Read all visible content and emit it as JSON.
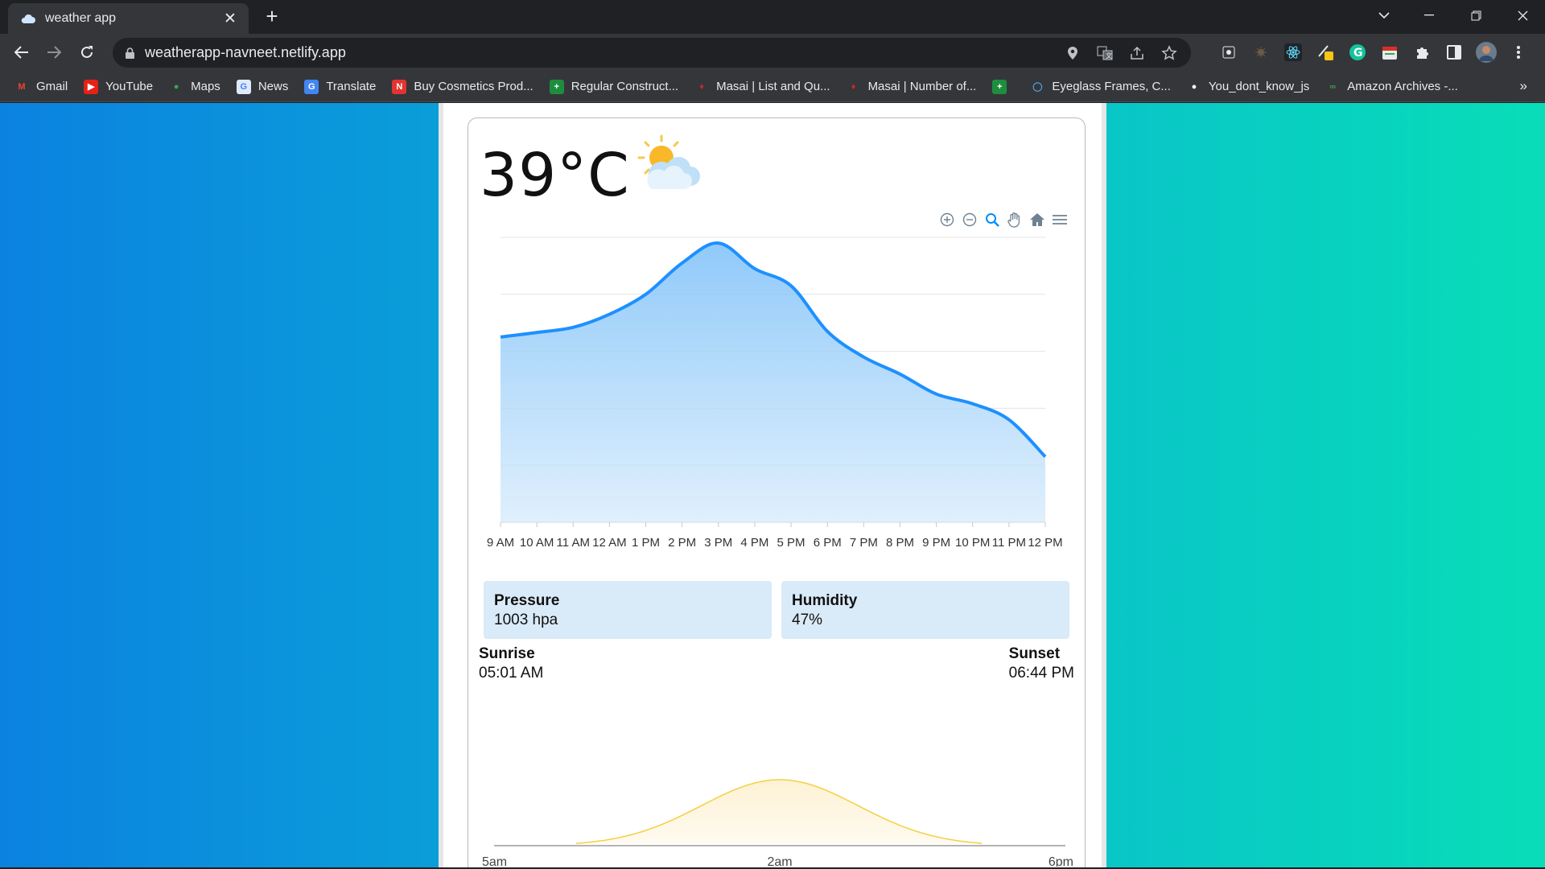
{
  "browser": {
    "tab_title": "weather app",
    "url": "weatherapp-navneet.netlify.app",
    "bookmarks": [
      {
        "label": "Gmail",
        "icon": "gmail-icon"
      },
      {
        "label": "YouTube",
        "icon": "youtube-icon"
      },
      {
        "label": "Maps",
        "icon": "maps-icon"
      },
      {
        "label": "News",
        "icon": "news-icon"
      },
      {
        "label": "Translate",
        "icon": "translate-icon"
      },
      {
        "label": "Buy Cosmetics Prod...",
        "icon": "cosmetics-icon"
      },
      {
        "label": "Regular Construct...",
        "icon": "sheets-icon"
      },
      {
        "label": "Masai | List and Qu...",
        "icon": "masai-icon"
      },
      {
        "label": "Masai | Number of...",
        "icon": "masai-icon"
      },
      {
        "label": "",
        "icon": "sheets-icon"
      },
      {
        "label": "Eyeglass Frames, C...",
        "icon": "eyeglass-icon"
      },
      {
        "label": "You_dont_know_js",
        "icon": "github-icon"
      },
      {
        "label": "Amazon Archives -...",
        "icon": "amazon-icon"
      }
    ],
    "bookmarks_more": "»"
  },
  "weather": {
    "temperature": "39°C",
    "icon": "partly-cloudy-sun-icon",
    "pressure_label": "Pressure",
    "pressure_value": "1003 hpa",
    "humidity_label": "Humidity",
    "humidity_value": "47%",
    "sunrise_label": "Sunrise",
    "sunrise_value": "05:01 AM",
    "sunset_label": "Sunset",
    "sunset_value": "06:44 PM"
  },
  "chart_data": [
    {
      "type": "area",
      "title": "",
      "xlabel": "",
      "ylabel": "",
      "categories": [
        "9 AM",
        "10 AM",
        "11 AM",
        "12 AM",
        "1 PM",
        "2 PM",
        "3 PM",
        "4 PM",
        "5 PM",
        "6 PM",
        "7 PM",
        "8 PM",
        "9 PM",
        "10 PM",
        "11 PM",
        "12 PM"
      ],
      "values": [
        32.5,
        33.3,
        34.2,
        36.5,
        40.0,
        45.5,
        49.0,
        44.5,
        41.5,
        33.5,
        29.0,
        26.0,
        22.5,
        20.8,
        18.0,
        11.5
      ],
      "ylim": [
        0,
        50
      ],
      "grid": true,
      "color": "#1e90ff"
    },
    {
      "type": "area",
      "title": "",
      "categories": [
        "5am",
        "2am",
        "6pm"
      ],
      "values": [
        0,
        1,
        0
      ],
      "color": "#f4d03f"
    }
  ]
}
